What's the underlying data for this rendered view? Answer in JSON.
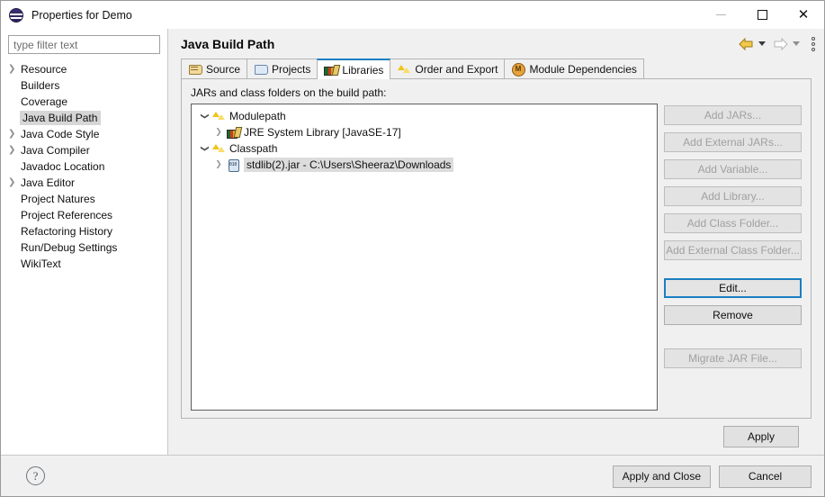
{
  "window": {
    "title": "Properties for Demo",
    "icon": "eclipse-icon",
    "controls": {
      "minimize": "minimize-icon",
      "maximize": "maximize-icon",
      "close": "close-icon"
    }
  },
  "sidebar": {
    "filter": {
      "placeholder": "type filter text",
      "value": ""
    },
    "items": [
      {
        "label": "Resource",
        "expandable": true
      },
      {
        "label": "Builders",
        "expandable": false
      },
      {
        "label": "Coverage",
        "expandable": false
      },
      {
        "label": "Java Build Path",
        "expandable": false,
        "selected": true
      },
      {
        "label": "Java Code Style",
        "expandable": true
      },
      {
        "label": "Java Compiler",
        "expandable": true
      },
      {
        "label": "Javadoc Location",
        "expandable": false
      },
      {
        "label": "Java Editor",
        "expandable": true
      },
      {
        "label": "Project Natures",
        "expandable": false
      },
      {
        "label": "Project References",
        "expandable": false
      },
      {
        "label": "Refactoring History",
        "expandable": false
      },
      {
        "label": "Run/Debug Settings",
        "expandable": false
      },
      {
        "label": "WikiText",
        "expandable": false
      }
    ]
  },
  "header": {
    "title": "Java Build Path",
    "tools": {
      "back": "back-arrow-icon",
      "back_menu": "chevron-down-icon",
      "forward": "forward-arrow-icon",
      "forward_menu": "chevron-down-icon",
      "view_menu": "view-menu-icon"
    }
  },
  "tabs": [
    {
      "label": "Source",
      "icon": "source-folder-icon",
      "active": false
    },
    {
      "label": "Projects",
      "icon": "projects-folder-icon",
      "active": false
    },
    {
      "label": "Libraries",
      "icon": "libraries-books-icon",
      "active": true
    },
    {
      "label": "Order and Export",
      "icon": "order-export-icon",
      "active": false
    },
    {
      "label": "Module Dependencies",
      "icon": "module-dependencies-icon",
      "active": false
    }
  ],
  "panel": {
    "label": "JARs and class folders on the build path:",
    "tree": [
      {
        "label": "Modulepath",
        "icon": "modulepath-icon",
        "indent": 0,
        "expander": "expanded",
        "selected": false
      },
      {
        "label": "JRE System Library [JavaSE-17]",
        "icon": "jre-library-icon",
        "indent": 1,
        "expander": "collapsed",
        "selected": false
      },
      {
        "label": "Classpath",
        "icon": "classpath-icon",
        "indent": 0,
        "expander": "expanded",
        "selected": false
      },
      {
        "label": "stdlib(2).jar - C:\\Users\\Sheeraz\\Downloads",
        "icon": "jar-icon",
        "indent": 1,
        "expander": "collapsed",
        "selected": true
      }
    ],
    "buttons": [
      {
        "label": "Add JARs...",
        "state": "disabled"
      },
      {
        "label": "Add External JARs...",
        "state": "disabled"
      },
      {
        "label": "Add Variable...",
        "state": "disabled"
      },
      {
        "label": "Add Library...",
        "state": "disabled"
      },
      {
        "label": "Add Class Folder...",
        "state": "disabled"
      },
      {
        "label": "Add External Class Folder...",
        "state": "disabled"
      },
      {
        "label": "Edit...",
        "state": "focused"
      },
      {
        "label": "Remove",
        "state": "enabled"
      },
      {
        "label": "Migrate JAR File...",
        "state": "disabled"
      }
    ],
    "apply_label": "Apply"
  },
  "footer": {
    "help": "help-icon",
    "apply_and_close": "Apply and Close",
    "cancel": "Cancel"
  },
  "colors": {
    "accent": "#1a7fc1",
    "window_bg": "#f0f0f0",
    "selection": "#d6d6d6",
    "tree_selection": "#dcdcdc"
  }
}
